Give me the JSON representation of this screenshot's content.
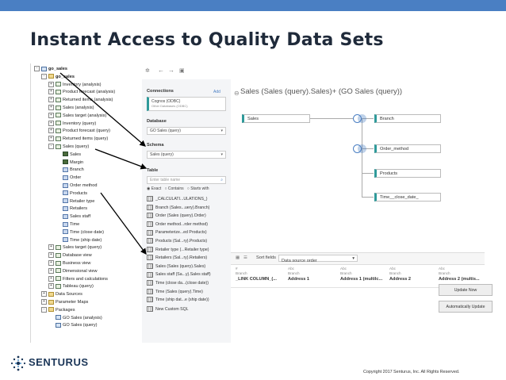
{
  "slide": {
    "title": "Instant Access to Quality Data Sets",
    "copyright": "Copyright 2017 Senturus, Inc. All Rights Reserved.",
    "logo_text": "SENTURUS",
    "topbar_color": "#4a7fc3"
  },
  "tree": {
    "items": [
      {
        "label": "go_sales",
        "toggle": "-",
        "icon": "pkg",
        "indent": 0
      },
      {
        "label": "go_sales",
        "toggle": "-",
        "icon": "folder",
        "indent": 1
      },
      {
        "label": "Inventory (analysis)",
        "toggle": "+",
        "icon": "query",
        "indent": 2
      },
      {
        "label": "Product forecast (analysis)",
        "toggle": "+",
        "icon": "query",
        "indent": 2
      },
      {
        "label": "Returned items (analysis)",
        "toggle": "+",
        "icon": "query",
        "indent": 2
      },
      {
        "label": "Sales (analysis)",
        "toggle": "+",
        "icon": "query",
        "indent": 2
      },
      {
        "label": "Sales target (analysis)",
        "toggle": "+",
        "icon": "query",
        "indent": 2
      },
      {
        "label": "Inventory (query)",
        "toggle": "+",
        "icon": "query",
        "indent": 2
      },
      {
        "label": "Product forecast (query)",
        "toggle": "+",
        "icon": "query",
        "indent": 2
      },
      {
        "label": "Returned items (query)",
        "toggle": "+",
        "icon": "query",
        "indent": 2
      },
      {
        "label": "Sales (query)",
        "toggle": "-",
        "icon": "query",
        "indent": 2
      },
      {
        "label": "Sales",
        "toggle": "",
        "icon": "meas",
        "indent": 3
      },
      {
        "label": "Margin",
        "toggle": "",
        "icon": "meas",
        "indent": 3
      },
      {
        "label": "Branch",
        "toggle": "",
        "icon": "dim",
        "indent": 3
      },
      {
        "label": "Order",
        "toggle": "",
        "icon": "dim",
        "indent": 3
      },
      {
        "label": "Order method",
        "toggle": "",
        "icon": "dim",
        "indent": 3
      },
      {
        "label": "Products",
        "toggle": "",
        "icon": "dim",
        "indent": 3
      },
      {
        "label": "Retailer type",
        "toggle": "",
        "icon": "dim",
        "indent": 3
      },
      {
        "label": "Retailers",
        "toggle": "",
        "icon": "dim",
        "indent": 3
      },
      {
        "label": "Sales staff",
        "toggle": "",
        "icon": "dim",
        "indent": 3
      },
      {
        "label": "Time",
        "toggle": "",
        "icon": "dim",
        "indent": 3
      },
      {
        "label": "Time (close date)",
        "toggle": "",
        "icon": "dim",
        "indent": 3
      },
      {
        "label": "Time (ship date)",
        "toggle": "",
        "icon": "dim",
        "indent": 3
      },
      {
        "label": "Sales target (query)",
        "toggle": "+",
        "icon": "query",
        "indent": 2
      },
      {
        "label": "Database view",
        "toggle": "+",
        "icon": "query",
        "indent": 2
      },
      {
        "label": "Business view",
        "toggle": "+",
        "icon": "query",
        "indent": 2
      },
      {
        "label": "Dimensional view",
        "toggle": "+",
        "icon": "query",
        "indent": 2
      },
      {
        "label": "Filters and calculations",
        "toggle": "+",
        "icon": "query",
        "indent": 2
      },
      {
        "label": "Tableau (query)",
        "toggle": "+",
        "icon": "query",
        "indent": 2
      },
      {
        "label": "Data Sources",
        "toggle": "+",
        "icon": "folder",
        "indent": 1
      },
      {
        "label": "Parameter Maps",
        "toggle": "+",
        "icon": "folder",
        "indent": 1
      },
      {
        "label": "Packages",
        "toggle": "-",
        "icon": "folder",
        "indent": 1
      },
      {
        "label": "GO Sales (analysis)",
        "toggle": "",
        "icon": "pkg",
        "indent": 2
      },
      {
        "label": "GO Sales (query)",
        "toggle": "",
        "icon": "pkg",
        "indent": 2
      }
    ]
  },
  "panel": {
    "connections_label": "Connections",
    "add_label": "Add",
    "connection_name": "Cognos (ODBC)",
    "connection_sub": "Other Databases (ODBC)",
    "database_label": "Database",
    "database_value": "GO Sales (query)",
    "schema_label": "Schema",
    "schema_value": "Sales (query)",
    "table_label": "Table",
    "search_placeholder": "Enter table name",
    "radio_exact": "Exact",
    "radio_contains": "Contains",
    "radio_starts": "Starts with",
    "tables": [
      "_CALCULATI...ULATIONS_)",
      "Branch (Sales...uery).Branch)",
      "Order (Sales (query).Order)",
      "Order method...rder method)",
      "Parameterize...ed Products)",
      "Products (Sal...ry).Products)",
      "Retailer type (...Retailer type)",
      "Retailers (Sal...ry).Retailers)",
      "Sales (Sales (query).Sales)",
      "Sales staff (Sa...y).Sales staff)",
      "Time (close da...(close date))",
      "Time (Sales (query).Time)",
      "Time (ship dat...e (ship date))"
    ],
    "new_sql": "New Custom SQL"
  },
  "canvas": {
    "title": "Sales (Sales (query).Sales)+ (GO Sales (query))",
    "left_node": "Sales",
    "right_nodes": [
      "Branch",
      "Order_method",
      "Products",
      "Time__close_date_"
    ],
    "sort_label": "Sort fields",
    "sort_value": "Data source order",
    "columns": [
      {
        "type": "#",
        "source": "Branch",
        "name": "_LINK COLUMN_(..."
      },
      {
        "type": "Abc",
        "source": "Branch",
        "name": "Address 1"
      },
      {
        "type": "Abc",
        "source": "Branch",
        "name": "Address 1 (multilc..."
      },
      {
        "type": "Abc",
        "source": "Branch",
        "name": "Address 2"
      },
      {
        "type": "Abc",
        "source": "Branch",
        "name": "Address 2 (multis..."
      }
    ],
    "update_now": "Update Now",
    "auto_update": "Automatically Update"
  }
}
